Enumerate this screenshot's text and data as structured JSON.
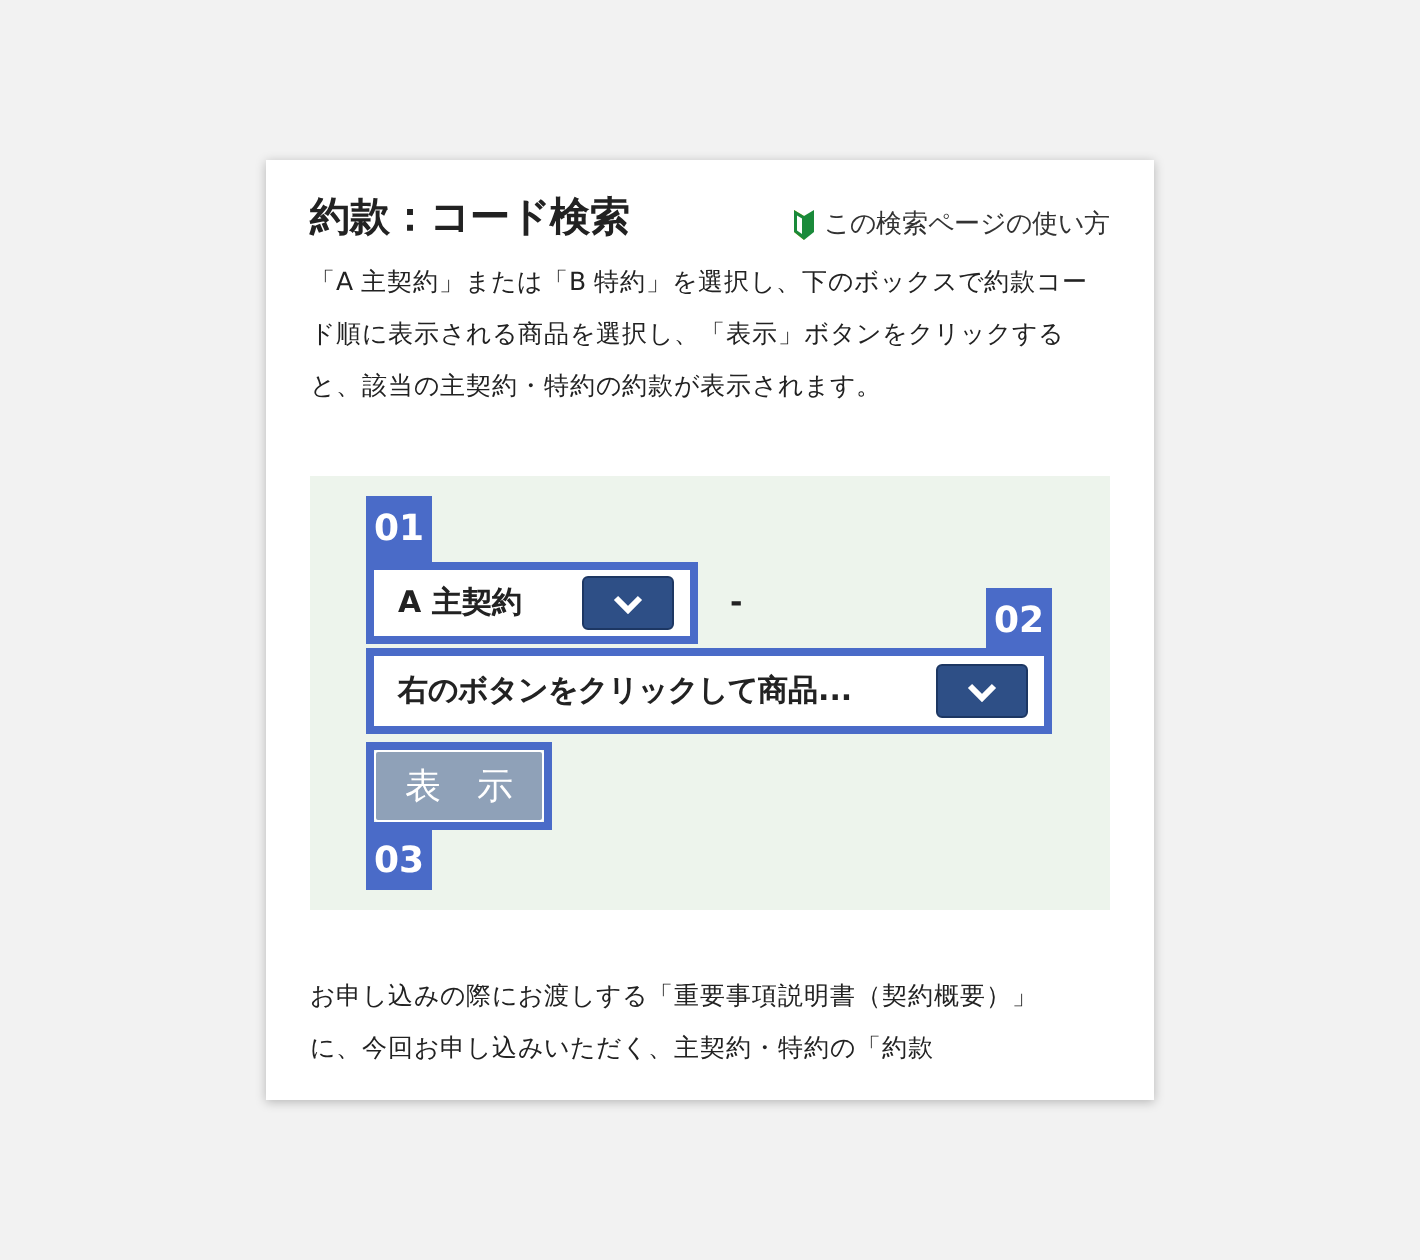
{
  "title": "約款：コード検索",
  "help_link": "この検索ページの使い方",
  "description": "「A 主契約」または「B 特約」を選択し、下のボックスで約款コード順に表示される商品を選択し、「表示」ボタンをクリックすると、該当の主契約・特約の約款が表示されます。",
  "demo": {
    "step_1": {
      "label": "01",
      "value": "A 主契約",
      "separator": "-"
    },
    "step_2": {
      "label": "02",
      "value": "右のボタンをクリックして商品..."
    },
    "step_3": {
      "label": "03",
      "button": "表　示",
      "disabled": true
    }
  },
  "note": "お申し込みの際にお渡しする「重要事項説明書（契約概要）」に、今回お申し込みいただく、主契約・特約の「約款"
}
